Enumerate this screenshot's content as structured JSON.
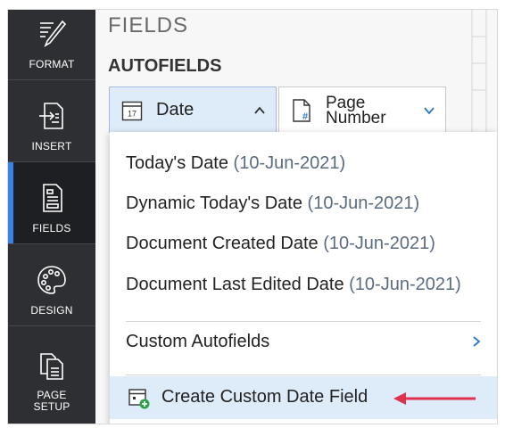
{
  "sidebar": {
    "items": [
      {
        "label": "FORMAT",
        "icon": "format-pen-icon"
      },
      {
        "label": "INSERT",
        "icon": "insert-icon"
      },
      {
        "label": "FIELDS",
        "icon": "fields-icon"
      },
      {
        "label": "DESIGN",
        "icon": "palette-icon"
      },
      {
        "label": "PAGE\nSETUP",
        "icon": "page-setup-icon"
      }
    ],
    "active_index": 2
  },
  "panel": {
    "title": "FIELDS",
    "section": "AUTOFIELDS",
    "date_button": {
      "label": "Date",
      "icon_text": "17"
    },
    "page_number_button": {
      "label_line1": "Page",
      "label_line2": "Number"
    }
  },
  "menu": {
    "items": [
      {
        "label": "Today's Date ",
        "meta": "(10-Jun-2021)"
      },
      {
        "label": "Dynamic Today's Date ",
        "meta": "(10-Jun-2021)"
      },
      {
        "label": "Document Created Date ",
        "meta": "(10-Jun-2021)"
      },
      {
        "label": "Document Last Edited Date ",
        "meta": "(10-Jun-2021)"
      }
    ],
    "custom_autofields": "Custom Autofields",
    "create_custom": "Create Custom Date Field"
  },
  "colors": {
    "sidebar_bg": "#2d2f33",
    "active_indicator": "#3b82e8",
    "highlight_bg": "#deebf9",
    "arrow": "#e0304e"
  }
}
